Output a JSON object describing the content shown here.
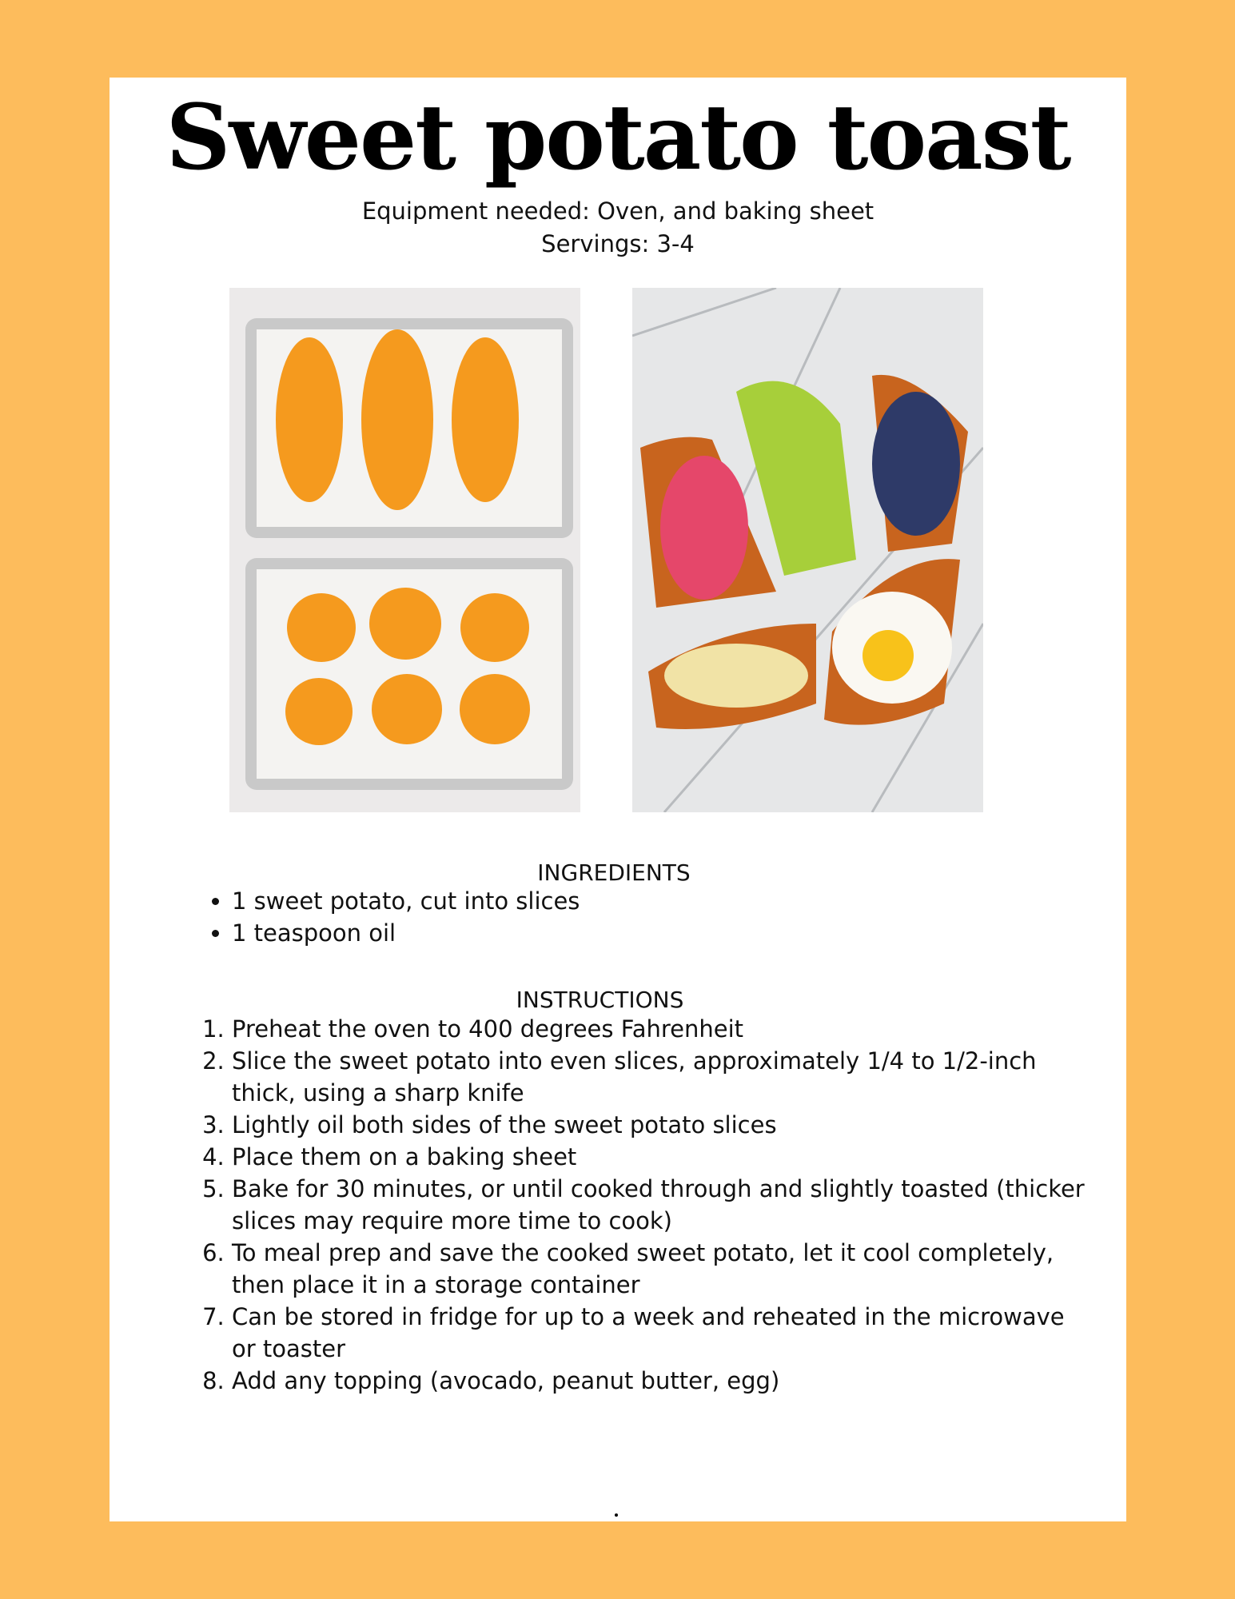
{
  "title": "Sweet potato toast",
  "equipment": "Equipment needed: Oven, and baking sheet",
  "servings": "Servings: 3-4",
  "images": {
    "left": "sliced sweet potato on baking sheets",
    "right": "sweet potato toasts with toppings"
  },
  "ingredients": {
    "heading": "INGREDIENTS",
    "items": [
      "1 sweet potato, cut into slices",
      "1 teaspoon oil"
    ]
  },
  "instructions": {
    "heading": "INSTRUCTIONS",
    "steps": [
      "Preheat the oven to 400 degrees Fahrenheit",
      "Slice the sweet potato into even slices, approximately 1/4 to 1/2-inch thick, using a sharp knife",
      "Lightly oil both sides of the sweet potato slices",
      "Place them on a baking sheet",
      "Bake for 30 minutes, or until cooked through and slightly toasted (thicker slices may require more time to cook)",
      "To meal prep and save the cooked sweet potato, let it cool completely, then place it in a storage container",
      "Can be stored in fridge for up to a week and reheated in the microwave or toaster",
      "Add any topping (avocado, peanut butter, egg)"
    ]
  },
  "colors": {
    "background": "#FDBC5C",
    "card": "#FFFFFF",
    "potato": "#F59A1E"
  }
}
